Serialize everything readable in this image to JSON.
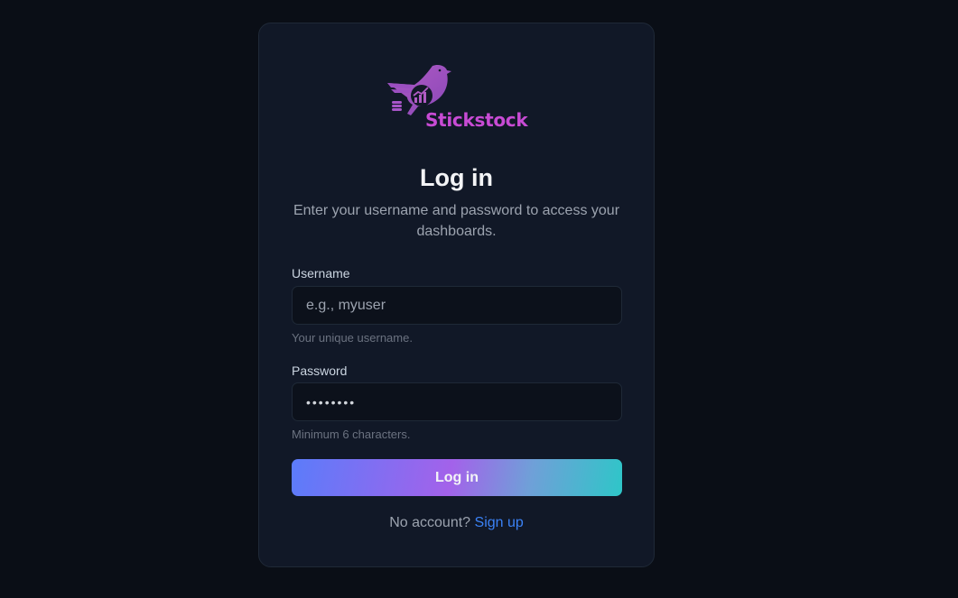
{
  "brand": {
    "name": "Stickstock",
    "logo_icon": "bird-chart-icon",
    "logo_color": "#c84bd4"
  },
  "header": {
    "title": "Log in",
    "subtitle": "Enter your username and password to access your dashboards."
  },
  "form": {
    "username": {
      "label": "Username",
      "placeholder": "e.g., myuser",
      "value": "",
      "hint": "Your unique username."
    },
    "password": {
      "label": "Password",
      "value": "••••••••",
      "hint": "Minimum 6 characters."
    },
    "submit_label": "Log in"
  },
  "footer": {
    "prompt": "No account?",
    "link_label": "Sign up"
  },
  "colors": {
    "background": "#0a0e16",
    "card": "#111827",
    "button_gradient": [
      "#5b7cfa",
      "#a362ea",
      "#2ec6c8"
    ],
    "link": "#3b82f6"
  }
}
